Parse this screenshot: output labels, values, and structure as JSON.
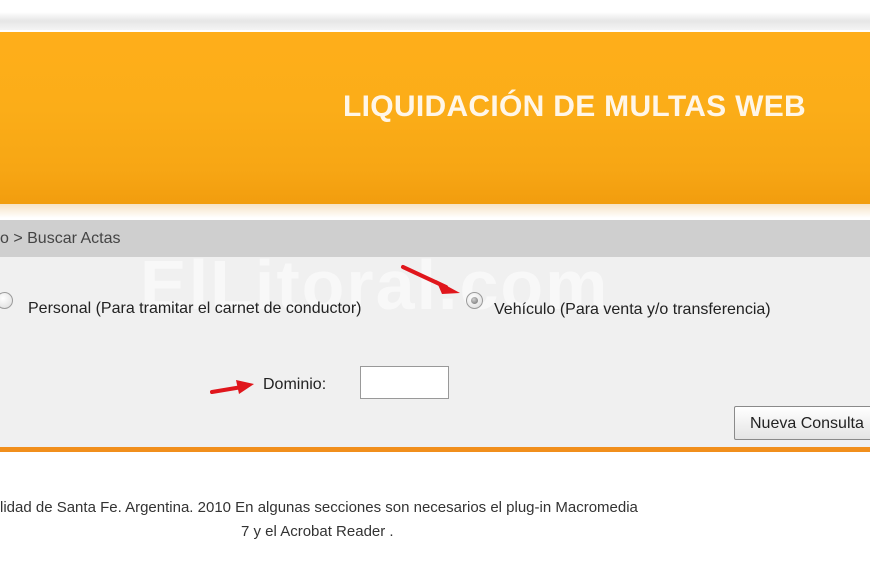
{
  "header": {
    "title": "LIQUIDACIÓN DE MULTAS WEB"
  },
  "breadcrumb": {
    "text": "o > Buscar Actas"
  },
  "watermark": {
    "text": "ElLitoral.com"
  },
  "search": {
    "option_personal_label": "Personal (Para tramitar el carnet de conductor)",
    "option_vehiculo_label": "Vehículo (Para venta y/o transferencia)",
    "selected": "vehiculo",
    "dominio_label": "Dominio:",
    "dominio_value": "",
    "button_label": "Nueva Consulta"
  },
  "footer": {
    "line1": "lidad de Santa Fe. Argentina. 2010 En algunas secciones son necesarios el plug-in Macromedia",
    "line2": "7 y el Acrobat Reader ."
  },
  "colors": {
    "banner": "#fbad18",
    "annotation_arrow": "#e0161c",
    "accent_line": "#f18f1c"
  }
}
